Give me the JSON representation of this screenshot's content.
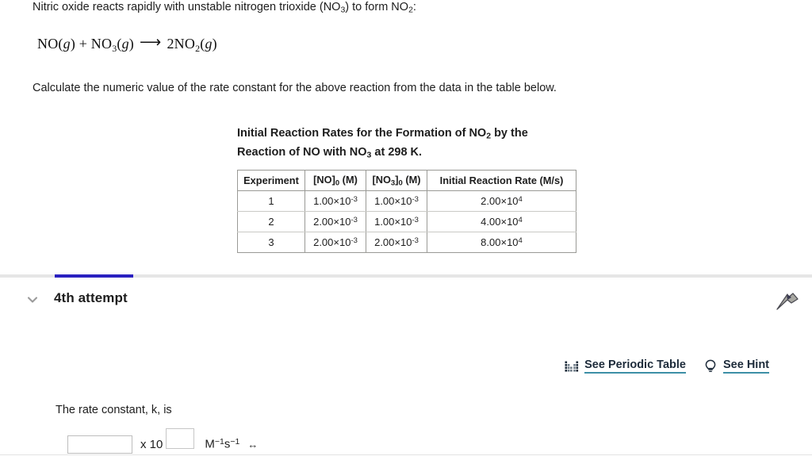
{
  "question": {
    "intro_before": "Nitric oxide reacts rapidly with unstable nitrogen trioxide (NO",
    "intro_sub1": "3",
    "intro_mid": ") to form NO",
    "intro_sub2": "2",
    "intro_end": ":",
    "equation": {
      "reactant1": "NO",
      "reactant1_state": "g",
      "plus": "+",
      "reactant2": "NO",
      "reactant2_sub": "3",
      "reactant2_state": "g",
      "arrow": "⟶",
      "product_coeff": "2",
      "product": "NO",
      "product_sub": "2",
      "product_state": "g"
    },
    "instruction": "Calculate the numeric value of the rate constant for the above reaction from the data in the table below."
  },
  "table": {
    "caption_part1": "Initial Reaction Rates for the Formation of NO",
    "caption_sub1": "2",
    "caption_part2": " by the Reaction of NO with NO",
    "caption_sub2": "3",
    "caption_part3": " at 298 K.",
    "headers": [
      {
        "text": "Experiment",
        "sub": "",
        "tail": ""
      },
      {
        "text": "[NO]",
        "sub": "0",
        "tail": " (M)"
      },
      {
        "text": "[NO",
        "sub2": "3",
        "sub": "0",
        "tail": " (M)"
      },
      {
        "text": "Initial Reaction Rate (M/s)",
        "sub": "",
        "tail": ""
      }
    ],
    "rows": [
      {
        "experiment": "1",
        "no_mantissa": "1.00×10",
        "no_exp": "-3",
        "no3_mantissa": "1.00×10",
        "no3_exp": "-3",
        "rate_mantissa": "2.00×10",
        "rate_exp": "4"
      },
      {
        "experiment": "2",
        "no_mantissa": "2.00×10",
        "no_exp": "-3",
        "no3_mantissa": "1.00×10",
        "no3_exp": "-3",
        "rate_mantissa": "4.00×10",
        "rate_exp": "4"
      },
      {
        "experiment": "3",
        "no_mantissa": "2.00×10",
        "no_exp": "-3",
        "no3_mantissa": "2.00×10",
        "no3_exp": "-3",
        "rate_mantissa": "8.00×10",
        "rate_exp": "4"
      }
    ]
  },
  "attempt": {
    "title": "4th attempt",
    "progress_color": "#2a20c0",
    "chevron_icon": "chevron-down-icon",
    "pointer_icon": "arrow-pointer-icon"
  },
  "helpers": [
    {
      "label": "See Periodic Table",
      "icon": "periodic-table-icon"
    },
    {
      "label": "See Hint",
      "icon": "lightbulb-icon"
    }
  ],
  "answer": {
    "label": "The rate constant, k, is",
    "value": "",
    "placeholder": "",
    "times_ten": "x 10",
    "exponent_value": "",
    "exponent_placeholder": "",
    "units_base1": "M",
    "units_exp1": "−1",
    "units_base2": "s",
    "units_exp2": "−1",
    "resize_glyph": "↔"
  },
  "colors": {
    "accent_blue": "#2a20c0",
    "link_underline": "#3d8fa6",
    "text": "#1d1d1d",
    "table_border": "#9a9a96"
  }
}
